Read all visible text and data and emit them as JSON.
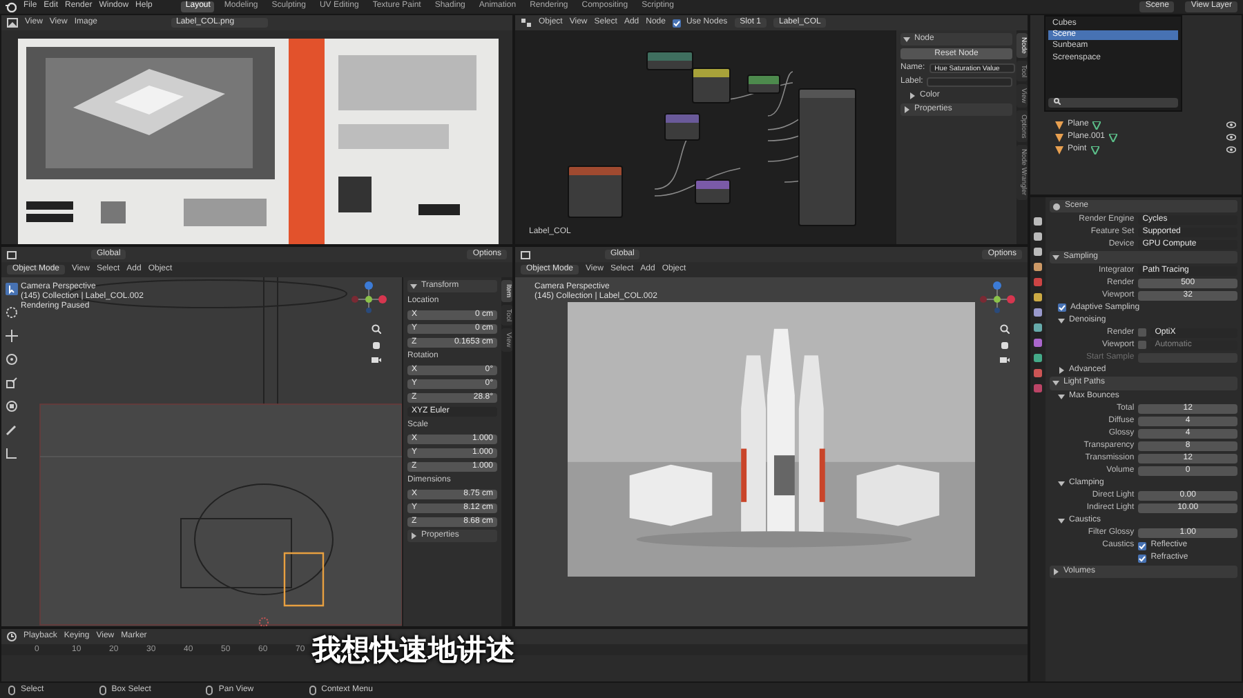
{
  "top_bar": {
    "menus": [
      "File",
      "Edit",
      "Render",
      "Window",
      "Help"
    ],
    "workspaces": [
      {
        "label": "Layout",
        "selected": true
      },
      {
        "label": "Modeling",
        "selected": false
      },
      {
        "label": "Sculpting",
        "selected": false
      },
      {
        "label": "UV Editing",
        "selected": false
      },
      {
        "label": "Texture Paint",
        "selected": false
      },
      {
        "label": "Shading",
        "selected": false
      },
      {
        "label": "Animation",
        "selected": false
      },
      {
        "label": "Rendering",
        "selected": false
      },
      {
        "label": "Compositing",
        "selected": false
      },
      {
        "label": "Scripting",
        "selected": false
      }
    ],
    "scene": "Scene",
    "view_layer": "View Layer"
  },
  "image_editor": {
    "menus": [
      "View",
      "View",
      "Image"
    ],
    "image_name": "Label_COL.png"
  },
  "node_editor": {
    "menus": [
      "Object",
      "View",
      "Select",
      "Add",
      "Node"
    ],
    "use_nodes": {
      "label": "Use Nodes",
      "checked": true
    },
    "slot": "Slot 1",
    "material": "Label_COL",
    "footer": "Label_COL",
    "nodes": [
      {
        "color": "#3f6f5f"
      },
      {
        "color": "#a8a23a"
      },
      {
        "color": "#4d8a4d"
      },
      {
        "color": "#6a5a9a"
      },
      {
        "color": "#a04a30"
      },
      {
        "color": "#7a5aa8"
      },
      {
        "color": "#555555"
      }
    ],
    "sidebar": {
      "tabs": [
        {
          "label": "Node",
          "selected": true
        },
        {
          "label": "Tool",
          "selected": false
        },
        {
          "label": "View",
          "selected": false
        },
        {
          "label": "Options",
          "selected": false
        },
        {
          "label": "Node Wrangler",
          "selected": false
        }
      ],
      "rows": [
        {
          "kind": "section",
          "label": "Node",
          "expanded": true
        },
        {
          "kind": "button",
          "label": "Reset Node"
        },
        {
          "kind": "text",
          "label": "Name:",
          "value": "Hue Saturation Value"
        },
        {
          "kind": "text",
          "label": "Label:",
          "value": ""
        },
        {
          "kind": "subsection",
          "label": "Color",
          "expanded": false
        },
        {
          "kind": "section",
          "label": "Properties",
          "expanded": false
        }
      ]
    }
  },
  "outliner": {
    "scene_menu": [
      {
        "label": "Cubes",
        "selected": false
      },
      {
        "label": "Scene",
        "selected": true
      },
      {
        "label": "Sunbeam",
        "selected": false
      },
      {
        "label": "Screenspace",
        "selected": false
      }
    ],
    "objects": [
      {
        "label": "Plane"
      },
      {
        "label": "Plane.001"
      },
      {
        "label": "Point"
      }
    ]
  },
  "viewport_left": {
    "menus": [
      "Object Mode",
      "View",
      "Select",
      "Add",
      "Object"
    ],
    "orientation": "Global",
    "options": "Options",
    "overlay": [
      "Camera Perspective",
      "(145) Collection | Label_COL.002",
      "Rendering Paused"
    ],
    "sidebar": {
      "tabs": [
        {
          "label": "Item",
          "selected": true
        },
        {
          "label": "Tool",
          "selected": false
        },
        {
          "label": "View",
          "selected": false
        }
      ],
      "rows": [
        {
          "kind": "section",
          "label": "Transform",
          "expanded": true
        },
        {
          "kind": "heading",
          "label": "Location"
        },
        {
          "kind": "axis",
          "label": "X",
          "value": "0 cm"
        },
        {
          "kind": "axis",
          "label": "Y",
          "value": "0 cm"
        },
        {
          "kind": "axis",
          "label": "Z",
          "value": "0.1653 cm"
        },
        {
          "kind": "heading",
          "label": "Rotation"
        },
        {
          "kind": "axis",
          "label": "X",
          "value": "0°"
        },
        {
          "kind": "axis",
          "label": "Y",
          "value": "0°"
        },
        {
          "kind": "axis",
          "label": "Z",
          "value": "28.8°"
        },
        {
          "kind": "select",
          "value": "XYZ Euler"
        },
        {
          "kind": "heading",
          "label": "Scale"
        },
        {
          "kind": "axis",
          "label": "X",
          "value": "1.000"
        },
        {
          "kind": "axis",
          "label": "Y",
          "value": "1.000"
        },
        {
          "kind": "axis",
          "label": "Z",
          "value": "1.000"
        },
        {
          "kind": "heading",
          "label": "Dimensions"
        },
        {
          "kind": "axis",
          "label": "X",
          "value": "8.75 cm"
        },
        {
          "kind": "axis",
          "label": "Y",
          "value": "8.12 cm"
        },
        {
          "kind": "axis",
          "label": "Z",
          "value": "8.68 cm"
        },
        {
          "kind": "section",
          "label": "Properties",
          "expanded": false
        }
      ]
    }
  },
  "viewport_right": {
    "menus": [
      "Object Mode",
      "View",
      "Select",
      "Add",
      "Object"
    ],
    "orientation": "Global",
    "options": "Options",
    "overlay": [
      "Camera Perspective",
      "(145) Collection | Label_COL.002"
    ]
  },
  "properties": {
    "title": "Scene",
    "rows": [
      {
        "kind": "select",
        "label": "Render Engine",
        "value": "Cycles"
      },
      {
        "kind": "select",
        "label": "Feature Set",
        "value": "Supported"
      },
      {
        "kind": "select",
        "label": "Device",
        "value": "GPU Compute"
      },
      {
        "kind": "section",
        "label": "Sampling",
        "expanded": true
      },
      {
        "kind": "select",
        "label": "Integrator",
        "value": "Path Tracing"
      },
      {
        "kind": "number",
        "label": "Render",
        "value": "500"
      },
      {
        "kind": "number",
        "label": "Viewport",
        "value": "32"
      },
      {
        "kind": "check",
        "text": "Adaptive Sampling",
        "checked": true
      },
      {
        "kind": "subsection",
        "label": "Denoising",
        "expanded": true
      },
      {
        "kind": "checkselect",
        "label": "Render",
        "checked": false,
        "value": "OptiX",
        "disabled": false
      },
      {
        "kind": "checkselect",
        "label": "Viewport",
        "checked": false,
        "value": "Automatic",
        "disabled": true
      },
      {
        "kind": "number",
        "label": "Start Sample",
        "value": "",
        "disabled": true
      },
      {
        "kind": "subsection",
        "label": "Advanced",
        "expanded": false
      },
      {
        "kind": "section",
        "label": "Light Paths",
        "expanded": true
      },
      {
        "kind": "subsection",
        "label": "Max Bounces",
        "expanded": true
      },
      {
        "kind": "number",
        "label": "Total",
        "value": "12"
      },
      {
        "kind": "number",
        "label": "Diffuse",
        "value": "4"
      },
      {
        "kind": "number",
        "label": "Glossy",
        "value": "4"
      },
      {
        "kind": "number",
        "label": "Transparency",
        "value": "8"
      },
      {
        "kind": "number",
        "label": "Transmission",
        "value": "12"
      },
      {
        "kind": "number",
        "label": "Volume",
        "value": "0"
      },
      {
        "kind": "subsection",
        "label": "Clamping",
        "expanded": true
      },
      {
        "kind": "number",
        "label": "Direct Light",
        "value": "0.00"
      },
      {
        "kind": "number",
        "label": "Indirect Light",
        "value": "10.00"
      },
      {
        "kind": "subsection",
        "label": "Caustics",
        "expanded": true
      },
      {
        "kind": "number",
        "label": "Filter Glossy",
        "value": "1.00"
      },
      {
        "kind": "check",
        "label": "Caustics",
        "text": "Reflective",
        "checked": true
      },
      {
        "kind": "check",
        "label": "",
        "text": "Refractive",
        "checked": true
      },
      {
        "kind": "section",
        "label": "Volumes",
        "expanded": false
      }
    ]
  },
  "timeline": {
    "menus": [
      "Playback",
      "Keying",
      "View",
      "Marker"
    ],
    "ticks": [
      "0",
      "10",
      "20",
      "30",
      "40",
      "50",
      "60",
      "70"
    ]
  },
  "status_bar": [
    "Select",
    "Box Select",
    "Pan View",
    "Context Menu"
  ],
  "subtitle": "我想快速地讲述"
}
